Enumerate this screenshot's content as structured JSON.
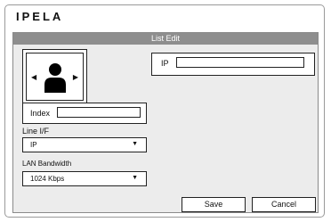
{
  "brand": {
    "logo": "IPELA"
  },
  "dialog": {
    "title": "List Edit",
    "camera_preview": {
      "icon": "person-icon",
      "prev": "◀",
      "next": "▶"
    },
    "ip": {
      "label": "IP",
      "value": ""
    },
    "index": {
      "label": "Index",
      "value": ""
    },
    "line_if": {
      "label": "Line I/F",
      "selected": "IP",
      "caret": "▼"
    },
    "lan_bandwidth": {
      "label": "LAN Bandwidth",
      "selected": "1024 Kbps",
      "caret": "▼"
    },
    "buttons": {
      "save": "Save",
      "cancel": "Cancel"
    }
  }
}
